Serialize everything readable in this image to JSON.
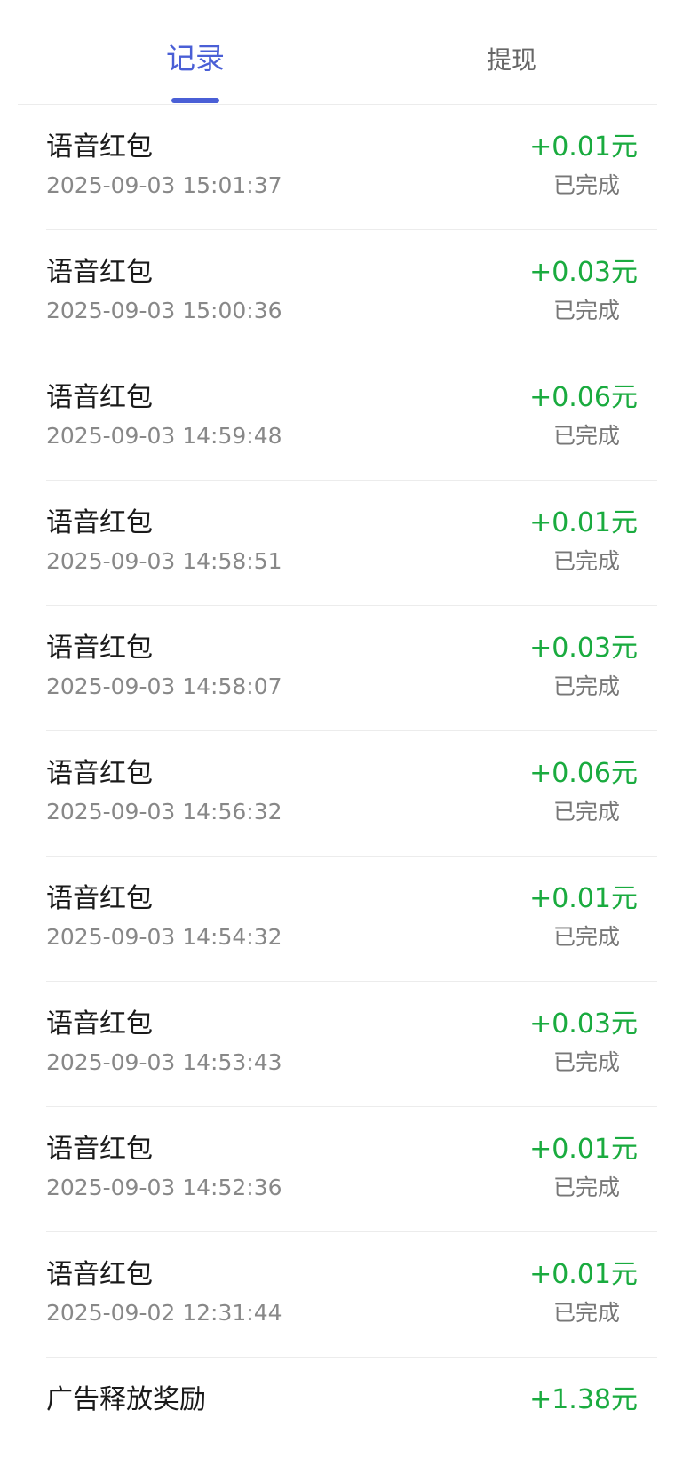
{
  "tabs": [
    {
      "label": "记录",
      "active": true
    },
    {
      "label": "提现",
      "active": false
    }
  ],
  "colors": {
    "accent": "#4a5fd6",
    "amount": "#1aab3f",
    "divider": "#ececec"
  },
  "records": [
    {
      "title": "语音红包",
      "time": "2025-09-03 15:01:37",
      "amount": "+0.01元",
      "status": "已完成"
    },
    {
      "title": "语音红包",
      "time": "2025-09-03 15:00:36",
      "amount": "+0.03元",
      "status": "已完成"
    },
    {
      "title": "语音红包",
      "time": "2025-09-03 14:59:48",
      "amount": "+0.06元",
      "status": "已完成"
    },
    {
      "title": "语音红包",
      "time": "2025-09-03 14:58:51",
      "amount": "+0.01元",
      "status": "已完成"
    },
    {
      "title": "语音红包",
      "time": "2025-09-03 14:58:07",
      "amount": "+0.03元",
      "status": "已完成"
    },
    {
      "title": "语音红包",
      "time": "2025-09-03 14:56:32",
      "amount": "+0.06元",
      "status": "已完成"
    },
    {
      "title": "语音红包",
      "time": "2025-09-03 14:54:32",
      "amount": "+0.01元",
      "status": "已完成"
    },
    {
      "title": "语音红包",
      "time": "2025-09-03 14:53:43",
      "amount": "+0.03元",
      "status": "已完成"
    },
    {
      "title": "语音红包",
      "time": "2025-09-03 14:52:36",
      "amount": "+0.01元",
      "status": "已完成"
    },
    {
      "title": "语音红包",
      "time": "2025-09-02 12:31:44",
      "amount": "+0.01元",
      "status": "已完成"
    },
    {
      "title": "广告释放奖励",
      "time": "",
      "amount": "+1.38元",
      "status": ""
    }
  ]
}
